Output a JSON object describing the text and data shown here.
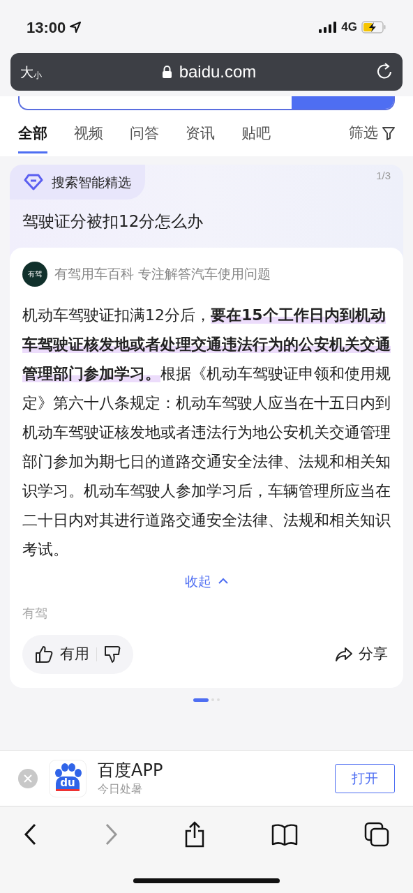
{
  "status_bar": {
    "time": "13:00",
    "network": "4G"
  },
  "url_bar": {
    "text_size": "大",
    "text_size_small": "小",
    "domain": "baidu.com"
  },
  "tabs": [
    {
      "label": "全部",
      "selected": true
    },
    {
      "label": "视频",
      "selected": false
    },
    {
      "label": "问答",
      "selected": false
    },
    {
      "label": "资讯",
      "selected": false
    },
    {
      "label": "贴吧",
      "selected": false
    }
  ],
  "filter": "筛选",
  "card": {
    "badge": "搜索智能精选",
    "page": "1/3",
    "question": "驾驶证分被扣12分怎么办",
    "source": {
      "logo_text": "有驾",
      "name": "有驾用车百科 专注解答汽车使用问题"
    },
    "answer": "机动车驾驶证扣满12分后，**要在15个工作日内到机动车驾驶证核发地或者处理交通违法行为的公安机关交通管理部门参加学习。**根据《机动车驾驶证申领和使用规定》第六十八条规定：机动车驾驶人应当在十五日内到机动车驾驶证核发地或者违法行为地公安机关交通管理部门参加为期七日的道路交通安全法律、法规和相关知识学习。机动车驾驶人参加学习后，车辆管理所应当在二十日内对其进行道路交通安全法律、法规和相关知识考试。",
    "collapse": "收起",
    "attribution": "有驾",
    "useful": "有用",
    "share": "分享"
  },
  "carousel_dots": [
    {
      "selected": true
    },
    {
      "selected": false
    },
    {
      "selected": false
    }
  ],
  "app_banner": {
    "logo_text": "du",
    "name": "百度APP",
    "subtitle": "今日处暑",
    "open": "打开"
  }
}
